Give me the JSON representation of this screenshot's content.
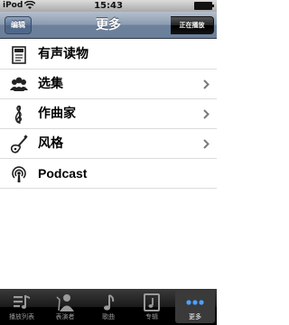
{
  "status": {
    "carrier": "iPod",
    "time": "15:43"
  },
  "nav": {
    "title": "更多",
    "edit_label": "编辑",
    "now_playing_label": "正在播放"
  },
  "list": {
    "items": [
      {
        "label": "有声读物",
        "icon": "audiobook-icon",
        "chevron": false
      },
      {
        "label": "选集",
        "icon": "compilations-icon",
        "chevron": true
      },
      {
        "label": "作曲家",
        "icon": "composer-icon",
        "chevron": true
      },
      {
        "label": "风格",
        "icon": "genre-icon",
        "chevron": true
      },
      {
        "label": "Podcast",
        "icon": "podcast-icon",
        "chevron": false
      }
    ]
  },
  "tabs": [
    {
      "label": "播放列表",
      "icon": "playlists-icon"
    },
    {
      "label": "表演者",
      "icon": "artists-icon"
    },
    {
      "label": "歌曲",
      "icon": "songs-icon"
    },
    {
      "label": "专辑",
      "icon": "albums-icon"
    },
    {
      "label": "更多",
      "icon": "more-icon",
      "active": true
    }
  ]
}
